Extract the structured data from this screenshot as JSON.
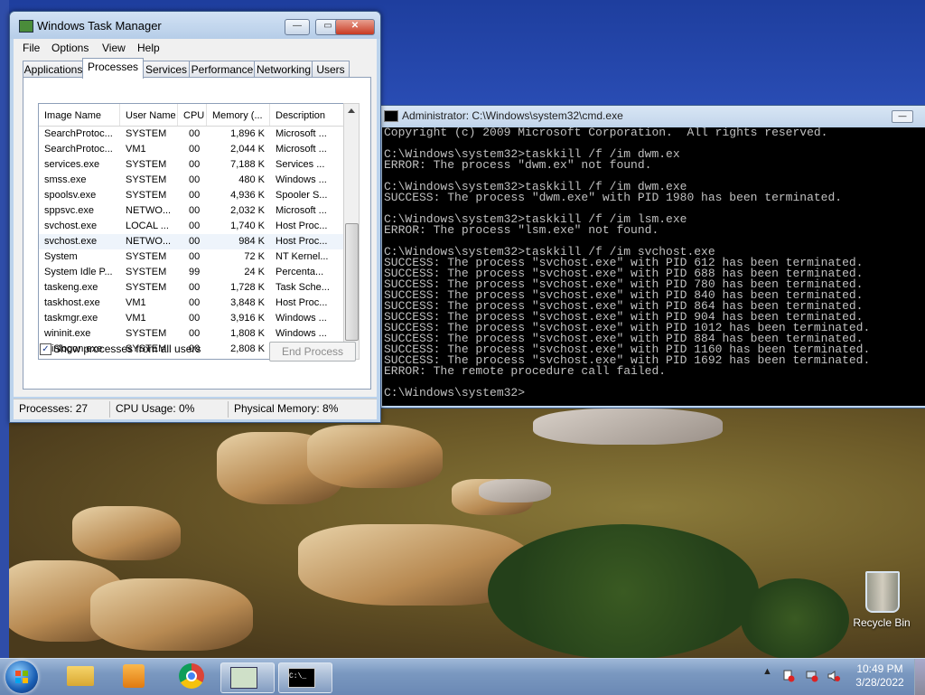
{
  "taskmgr": {
    "title": "Windows Task Manager",
    "menu": [
      "File",
      "Options",
      "View",
      "Help"
    ],
    "tabs": [
      "Applications",
      "Processes",
      "Services",
      "Performance",
      "Networking",
      "Users"
    ],
    "active_tab": "Processes",
    "columns": [
      "Image Name",
      "User Name",
      "CPU",
      "Memory (...",
      "Description"
    ],
    "rows": [
      [
        "SearchProtoc...",
        "SYSTEM",
        "00",
        "1,896 K",
        "Microsoft ..."
      ],
      [
        "SearchProtoc...",
        "VM1",
        "00",
        "2,044 K",
        "Microsoft ..."
      ],
      [
        "services.exe",
        "SYSTEM",
        "00",
        "7,188 K",
        "Services ..."
      ],
      [
        "smss.exe",
        "SYSTEM",
        "00",
        "480 K",
        "Windows ..."
      ],
      [
        "spoolsv.exe",
        "SYSTEM",
        "00",
        "4,936 K",
        "Spooler S..."
      ],
      [
        "sppsvc.exe",
        "NETWO...",
        "00",
        "2,032 K",
        "Microsoft ..."
      ],
      [
        "svchost.exe",
        "LOCAL ...",
        "00",
        "1,740 K",
        "Host Proc..."
      ],
      [
        "svchost.exe",
        "NETWO...",
        "00",
        "984 K",
        "Host Proc..."
      ],
      [
        "System",
        "SYSTEM",
        "00",
        "72 K",
        "NT Kernel..."
      ],
      [
        "System Idle P...",
        "SYSTEM",
        "99",
        "24 K",
        "Percenta..."
      ],
      [
        "taskeng.exe",
        "SYSTEM",
        "00",
        "1,728 K",
        "Task Sche..."
      ],
      [
        "taskhost.exe",
        "VM1",
        "00",
        "3,848 K",
        "Host Proc..."
      ],
      [
        "taskmgr.exe",
        "VM1",
        "00",
        "3,916 K",
        "Windows ..."
      ],
      [
        "wininit.exe",
        "SYSTEM",
        "00",
        "1,808 K",
        "Windows ..."
      ],
      [
        "winlogon.exe",
        "SYSTEM",
        "00",
        "2,808 K",
        "Windows ..."
      ]
    ],
    "show_all_label": "Show processes from all users",
    "show_all_checked": true,
    "end_process_label": "End Process",
    "status": {
      "processes": "Processes: 27",
      "cpu": "CPU Usage: 0%",
      "memory": "Physical Memory: 8%"
    }
  },
  "cmd": {
    "title": "Administrator: C:\\Windows\\system32\\cmd.exe",
    "lines": [
      "Copyright (c) 2009 Microsoft Corporation.  All rights reserved.",
      "",
      "C:\\Windows\\system32>taskkill /f /im dwm.ex",
      "ERROR: The process \"dwm.ex\" not found.",
      "",
      "C:\\Windows\\system32>taskkill /f /im dwm.exe",
      "SUCCESS: The process \"dwm.exe\" with PID 1980 has been terminated.",
      "",
      "C:\\Windows\\system32>taskkill /f /im lsm.exe",
      "ERROR: The process \"lsm.exe\" not found.",
      "",
      "C:\\Windows\\system32>taskkill /f /im svchost.exe",
      "SUCCESS: The process \"svchost.exe\" with PID 612 has been terminated.",
      "SUCCESS: The process \"svchost.exe\" with PID 688 has been terminated.",
      "SUCCESS: The process \"svchost.exe\" with PID 780 has been terminated.",
      "SUCCESS: The process \"svchost.exe\" with PID 840 has been terminated.",
      "SUCCESS: The process \"svchost.exe\" with PID 864 has been terminated.",
      "SUCCESS: The process \"svchost.exe\" with PID 904 has been terminated.",
      "SUCCESS: The process \"svchost.exe\" with PID 1012 has been terminated.",
      "SUCCESS: The process \"svchost.exe\" with PID 884 has been terminated.",
      "SUCCESS: The process \"svchost.exe\" with PID 1160 has been terminated.",
      "SUCCESS: The process \"svchost.exe\" with PID 1692 has been terminated.",
      "ERROR: The remote procedure call failed.",
      "",
      "C:\\Windows\\system32>"
    ]
  },
  "desktop": {
    "recycle_bin_label": "Recycle Bin"
  },
  "taskbar": {
    "apps": [
      "windows-explorer-icon",
      "media-player-icon",
      "chrome-icon",
      "task-manager-icon",
      "cmd-icon"
    ],
    "time": "10:49 PM",
    "date": "3/28/2022"
  }
}
